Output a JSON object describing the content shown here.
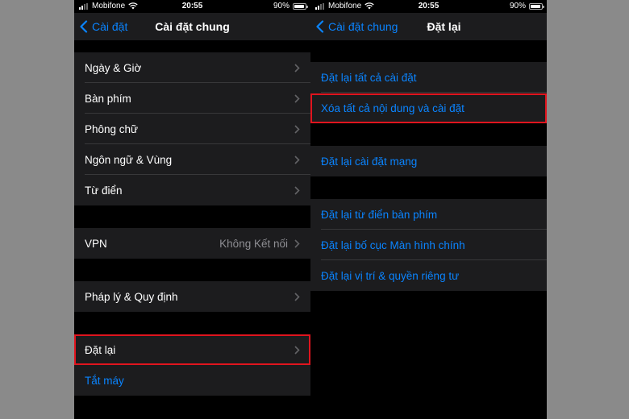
{
  "colors": {
    "accent": "#0a84ff",
    "highlight": "#e0141e",
    "cell_bg": "#1c1c1e"
  },
  "left_screen": {
    "status": {
      "carrier": "Mobifone",
      "time": "20:55",
      "battery": "90%"
    },
    "nav": {
      "back_label": "Cài đặt",
      "title": "Cài đặt chung"
    },
    "groups": [
      [
        {
          "label": "Ngày & Giờ"
        },
        {
          "label": "Bàn phím"
        },
        {
          "label": "Phông chữ"
        },
        {
          "label": "Ngôn ngữ & Vùng"
        },
        {
          "label": "Từ điển"
        }
      ],
      [
        {
          "label": "VPN",
          "value": "Không Kết nối"
        }
      ],
      [
        {
          "label": "Pháp lý & Quy định"
        }
      ],
      [
        {
          "label": "Đặt lại",
          "highlighted": true
        },
        {
          "label": "Tắt máy"
        }
      ]
    ]
  },
  "right_screen": {
    "status": {
      "carrier": "Mobifone",
      "time": "20:55",
      "battery": "90%"
    },
    "nav": {
      "back_label": "Cài đặt chung",
      "title": "Đặt lại"
    },
    "groups": [
      [
        {
          "label": "Đặt lại tất cả cài đặt"
        },
        {
          "label": "Xóa tất cả nội dung và cài đặt",
          "highlighted": true
        }
      ],
      [
        {
          "label": "Đặt lại cài đặt mạng"
        }
      ],
      [
        {
          "label": "Đặt lại từ điển bàn phím"
        },
        {
          "label": "Đặt lại bố cục Màn hình chính"
        },
        {
          "label": "Đặt lại vị trí & quyền riêng tư"
        }
      ]
    ]
  }
}
